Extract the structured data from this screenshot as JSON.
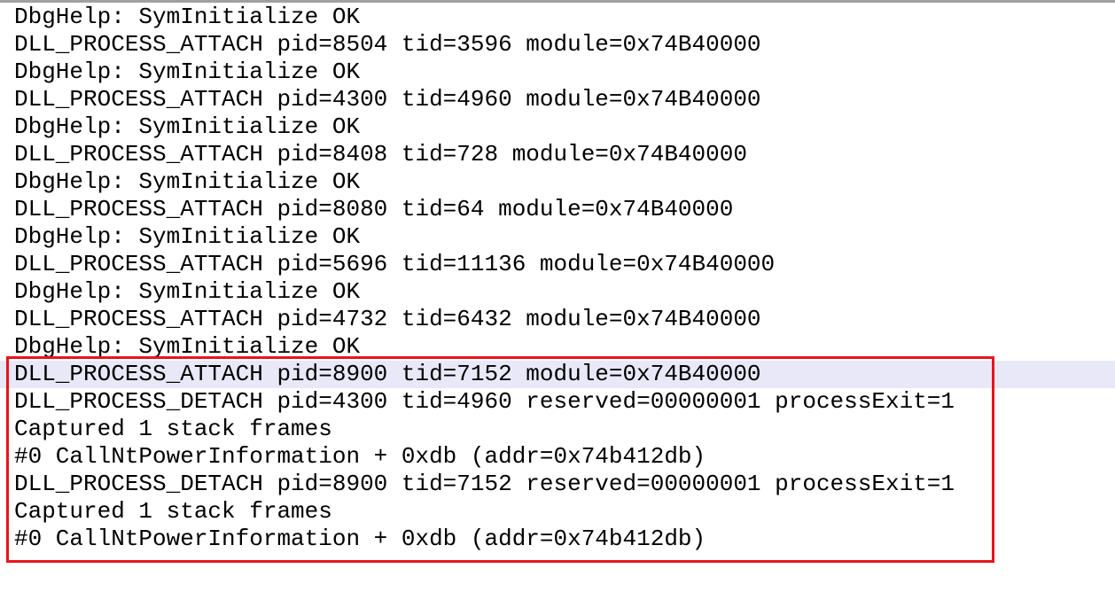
{
  "log": {
    "lines": [
      "DbgHelp: SymInitialize OK",
      "DLL_PROCESS_ATTACH pid=8504 tid=3596 module=0x74B40000",
      "DbgHelp: SymInitialize OK",
      "DLL_PROCESS_ATTACH pid=4300 tid=4960 module=0x74B40000",
      "DbgHelp: SymInitialize OK",
      "DLL_PROCESS_ATTACH pid=8408 tid=728 module=0x74B40000",
      "DbgHelp: SymInitialize OK",
      "DLL_PROCESS_ATTACH pid=8080 tid=64 module=0x74B40000",
      "DbgHelp: SymInitialize OK",
      "DLL_PROCESS_ATTACH pid=5696 tid=11136 module=0x74B40000",
      "DbgHelp: SymInitialize OK",
      "DLL_PROCESS_ATTACH pid=4732 tid=6432 module=0x74B40000",
      "DbgHelp: SymInitialize OK",
      "DLL_PROCESS_ATTACH pid=8900 tid=7152 module=0x74B40000",
      "DLL_PROCESS_DETACH pid=4300 tid=4960 reserved=00000001 processExit=1",
      "Captured 1 stack frames",
      "#0 CallNtPowerInformation + 0xdb (addr=0x74b412db)",
      "DLL_PROCESS_DETACH pid=8900 tid=7152 reserved=00000001 processExit=1",
      "Captured 1 stack frames",
      "#0 CallNtPowerInformation + 0xdb (addr=0x74b412db)"
    ],
    "selected_line_index": 13
  },
  "colors": {
    "highlight_border": "#e8141c",
    "selected_row_bg": "#e8e8f8",
    "text": "#000000"
  }
}
